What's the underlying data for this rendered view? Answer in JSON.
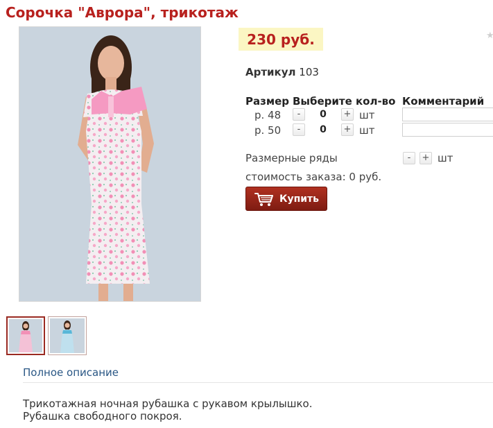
{
  "product": {
    "title": "Сорочка \"Аврора\", трикотаж",
    "price": "230 руб.",
    "sku_label": "Артикул",
    "sku_value": "103"
  },
  "gallery": {
    "main_image_alt": "model-in-pink-floral-nightgown",
    "thumbnails": [
      {
        "name": "pink-nightgown",
        "active": true
      },
      {
        "name": "blue-nightgown",
        "active": false
      }
    ]
  },
  "order_table": {
    "headers": {
      "size": "Размер",
      "quantity": "Выберите кол-во",
      "comment": "Комментарий"
    },
    "rows": [
      {
        "size": "р. 48",
        "qty": "0",
        "unit": "шт",
        "minus": "-",
        "plus": "+",
        "comment": ""
      },
      {
        "size": "р. 50",
        "qty": "0",
        "unit": "шт",
        "minus": "-",
        "plus": "+",
        "comment": ""
      }
    ],
    "size_ranges": {
      "label": "Размерные ряды",
      "minus": "-",
      "plus": "+",
      "unit": "шт"
    }
  },
  "order_total": "стоимость заказа: 0 руб.",
  "buy_button": {
    "label": "Купить",
    "icon": "cart-icon"
  },
  "description": {
    "link": "Полное описание",
    "lines": [
      "Трикотажная ночная рубашка с рукавом крылышко.",
      "Рубашка свободного покроя."
    ]
  },
  "colors": {
    "title_red": "#b8211e",
    "price_bg": "#fbf6c3",
    "buy_button": "#9c2618",
    "link_blue": "#2a5785"
  }
}
